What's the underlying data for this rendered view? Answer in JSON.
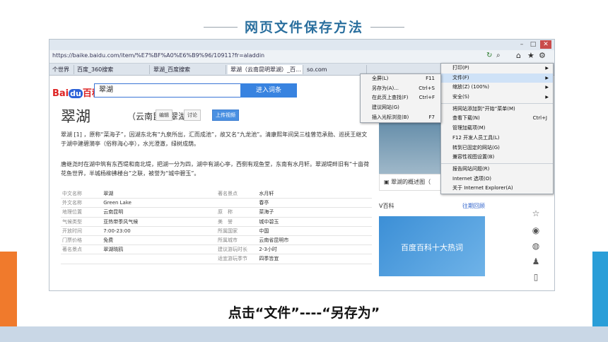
{
  "slide": {
    "title": "网页文件保存方法",
    "caption": "点击“文件”----“另存为”"
  },
  "browser": {
    "url": "https://baike.baidu.com/item/%E7%BF%A0%E6%B9%96/10911?fr=aladdin",
    "tabs": [
      {
        "label": "个世界"
      },
      {
        "label": "百度_360搜索"
      },
      {
        "label": "翠湖_百度搜索"
      },
      {
        "label": "翠湖（云南昆明翠湖）_百..."
      },
      {
        "label": "so.com"
      }
    ]
  },
  "page": {
    "logo_text": "Bai",
    "logo_du": "du",
    "logo_baike": "百科",
    "search_value": "翠湖",
    "search_button": "进入词条",
    "title": "翠湖",
    "subtitle": "（云南昆明翠湖）",
    "edit_label": "编辑",
    "discuss_label": "讨论",
    "upload_label": "上传视频",
    "para1": "翠湖 [1] ，原称“菜海子”，因湖东北有“九泉所出，汇而成池”，故又名“九龙池”。清康熙年间吴三桂曾范承勋、巡抚王继文于湖中建碧漪亭（俗称海心亭），水光澄澈，绿树成荫。",
    "para2": "唐继尧时在湖中筑有东西堤和南北堤，把湖一分为四，湖中有湖心亭，西侧有观鱼堂，东南有水月轩。翠湖堤畔旧有“十亩荷花鱼世界，半城杨柳拂楼台”之联，被誉为“城中碧玉”。",
    "info_left": [
      {
        "k": "中文名称",
        "v": "翠湖"
      },
      {
        "k": "外文名称",
        "v": "Green Lake"
      },
      {
        "k": "地理位置",
        "v": "云南昆明"
      },
      {
        "k": "气候类型",
        "v": "亚热带季风气候"
      },
      {
        "k": "开放时间",
        "v": "7:00-23:00"
      },
      {
        "k": "门票价格",
        "v": "免费"
      },
      {
        "k": "著名景点",
        "v": "翠湖晓鸥"
      }
    ],
    "info_right": [
      {
        "k": "著名景点",
        "v": "水月轩"
      },
      {
        "k": "",
        "v": "春亭"
      },
      {
        "k": "原　称",
        "v": "菜海子"
      },
      {
        "k": "美　誉",
        "v": "城中碧玉"
      },
      {
        "k": "所属国家",
        "v": "中国"
      },
      {
        "k": "所属城市",
        "v": "云南省昆明市"
      },
      {
        "k": "建议游玩时长",
        "v": "2-3小时"
      },
      {
        "k": "适宜游玩季节",
        "v": "四季皆宜"
      }
    ],
    "photo_caption": "翠湖的概述图（",
    "baike_label": "V百科",
    "baike_more": "往期回顾",
    "banner_text": "百度百科十大热词"
  },
  "file_menu": {
    "items": [
      {
        "label": "打印(P)",
        "arrow": true
      },
      {
        "label": "文件(F)",
        "arrow": true
      },
      {
        "label": "缩放(Z) (100%)",
        "arrow": true
      },
      {
        "label": "安全(S)",
        "arrow": true
      },
      {
        "label": "将网站添加到“开始”菜单(M)"
      },
      {
        "label": "查看下载(N)",
        "shortcut": "Ctrl+J"
      },
      {
        "label": "管理加载项(M)"
      },
      {
        "label": "F12 开发人员工具(L)"
      },
      {
        "label": "转到已固定的网站(G)"
      },
      {
        "label": "兼容性视图设置(B)"
      },
      {
        "label": "报告网站问题(R)"
      },
      {
        "label": "Internet 选项(O)"
      },
      {
        "label": "关于 Internet Explorer(A)"
      }
    ]
  },
  "sub_menu": {
    "items": [
      {
        "label": "全屏(L)",
        "shortcut": "F11"
      },
      {
        "label": "另存为(A)...",
        "shortcut": "Ctrl+S"
      },
      {
        "label": "在此页上查找(F)",
        "shortcut": "Ctrl+F"
      },
      {
        "label": "建议网站(G)"
      },
      {
        "label": "插入光标浏览(B)",
        "shortcut": "F7"
      }
    ]
  }
}
